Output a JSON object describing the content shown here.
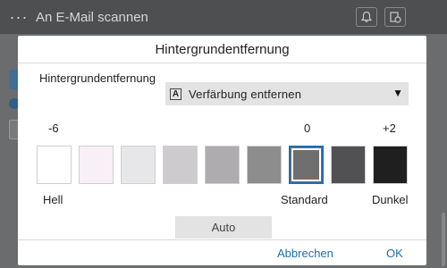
{
  "topbar": {
    "menu_label": "···",
    "title": "An E-Mail scannen",
    "icons": [
      "bell-icon",
      "job-status-icon"
    ]
  },
  "dialog": {
    "title": "Hintergrundentfernung",
    "setting_label": "Hintergrundentfernung",
    "select": {
      "icon_letter": "A",
      "value": "Verfärbung entfernen",
      "arrow": "▼"
    },
    "scale_numbers": {
      "min": "-6",
      "mid": "0",
      "max": "+2"
    },
    "levels": [
      {
        "color": "#ffffff",
        "selected": false
      },
      {
        "color": "#f8f0f6",
        "selected": false
      },
      {
        "color": "#e7e6e9",
        "selected": false
      },
      {
        "color": "#cdcbce",
        "selected": false
      },
      {
        "color": "#aeacaf",
        "selected": false
      },
      {
        "color": "#8d8d8d",
        "selected": false
      },
      {
        "color": "#6f6f6f",
        "selected": true
      },
      {
        "color": "#515052",
        "selected": false
      },
      {
        "color": "#1f1f1f",
        "selected": false
      }
    ],
    "selected_level": 0,
    "scale_labels": {
      "light": "Hell",
      "standard": "Standard",
      "dark": "Dunkel"
    },
    "auto_label": "Auto",
    "cancel_label": "Abbrechen",
    "ok_label": "OK"
  },
  "colors": {
    "accent": "#1f6fb2",
    "overlay": "#5f6062"
  }
}
